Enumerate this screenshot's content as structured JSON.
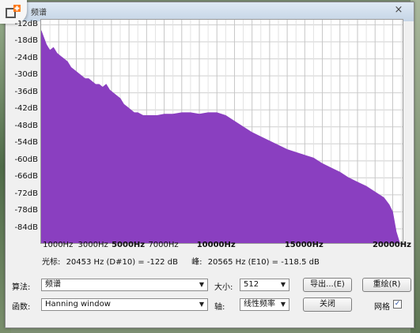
{
  "window": {
    "title": "频谱",
    "close_glyph": "×",
    "badge_icon": "app-badge-icon"
  },
  "chart_data": {
    "type": "area",
    "title": "",
    "xlabel": "",
    "ylabel": "",
    "fill_color": "#8a3fc0",
    "grid": true,
    "xlim": [
      0,
      20565
    ],
    "ylim": [
      -90,
      -12
    ],
    "y_tick_labels": [
      "-12dB",
      "-18dB",
      "-24dB",
      "-30dB",
      "-36dB",
      "-42dB",
      "-48dB",
      "-54dB",
      "-60dB",
      "-66dB",
      "-72dB",
      "-78dB",
      "-84dB"
    ],
    "y_ticks": [
      -12,
      -18,
      -24,
      -30,
      -36,
      -42,
      -48,
      -54,
      -60,
      -66,
      -72,
      -78,
      -84
    ],
    "x_tick_labels": [
      {
        "label": "1000Hz",
        "value": 1000,
        "bold": false
      },
      {
        "label": "3000Hz",
        "value": 3000,
        "bold": false
      },
      {
        "label": "5000Hz",
        "value": 5000,
        "bold": true
      },
      {
        "label": "7000Hz",
        "value": 7000,
        "bold": false
      },
      {
        "label": "10000Hz",
        "value": 10000,
        "bold": true
      },
      {
        "label": "15000Hz",
        "value": 15000,
        "bold": true
      },
      {
        "label": "20000Hz",
        "value": 20000,
        "bold": true
      }
    ],
    "points": [
      [
        0,
        -14
      ],
      [
        300,
        -19
      ],
      [
        500,
        -21
      ],
      [
        700,
        -20
      ],
      [
        900,
        -22
      ],
      [
        1100,
        -23
      ],
      [
        1300,
        -24
      ],
      [
        1500,
        -25
      ],
      [
        1700,
        -27
      ],
      [
        1900,
        -28
      ],
      [
        2100,
        -29
      ],
      [
        2300,
        -30
      ],
      [
        2500,
        -31
      ],
      [
        2700,
        -31
      ],
      [
        2900,
        -32
      ],
      [
        3100,
        -33
      ],
      [
        3300,
        -33
      ],
      [
        3500,
        -34
      ],
      [
        3700,
        -33
      ],
      [
        3900,
        -35
      ],
      [
        4100,
        -36
      ],
      [
        4300,
        -37
      ],
      [
        4500,
        -38
      ],
      [
        4700,
        -40
      ],
      [
        4900,
        -41
      ],
      [
        5100,
        -42
      ],
      [
        5300,
        -43
      ],
      [
        5500,
        -43
      ],
      [
        5800,
        -44
      ],
      [
        6200,
        -44
      ],
      [
        6600,
        -44
      ],
      [
        7000,
        -43.5
      ],
      [
        7500,
        -43.5
      ],
      [
        8000,
        -43
      ],
      [
        8500,
        -43
      ],
      [
        9000,
        -43.5
      ],
      [
        9500,
        -43
      ],
      [
        10000,
        -43
      ],
      [
        10500,
        -44
      ],
      [
        11000,
        -46
      ],
      [
        11500,
        -48
      ],
      [
        12000,
        -50
      ],
      [
        12500,
        -51.5
      ],
      [
        13000,
        -53
      ],
      [
        13500,
        -54.5
      ],
      [
        14000,
        -56
      ],
      [
        14500,
        -57
      ],
      [
        15000,
        -58
      ],
      [
        15500,
        -59
      ],
      [
        16000,
        -61
      ],
      [
        16500,
        -62.5
      ],
      [
        17000,
        -64
      ],
      [
        17500,
        -66
      ],
      [
        18000,
        -67.5
      ],
      [
        18500,
        -69
      ],
      [
        19000,
        -71
      ],
      [
        19500,
        -73
      ],
      [
        19800,
        -75.5
      ],
      [
        20000,
        -78
      ],
      [
        20200,
        -85
      ],
      [
        20400,
        -90
      ]
    ]
  },
  "cursor_info": {
    "cursor_label": "光标:",
    "cursor_value": "20453 Hz (D#10) = -122 dB",
    "peak_label": "峰:",
    "peak_value": "20565 Hz (E10) = -118.5 dB"
  },
  "controls": {
    "algorithm_label": "算法:",
    "algorithm_value": "频谱",
    "size_label": "大小:",
    "size_value": "512",
    "export_label": "导出...(E)",
    "replot_label": "重绘(R)",
    "function_label": "函数:",
    "function_value": "Hanning window",
    "axis_label": "轴:",
    "axis_value": "线性频率",
    "close_label": "关闭",
    "grid_label": "网格",
    "grid_checked": true,
    "check_glyph": "✓"
  }
}
